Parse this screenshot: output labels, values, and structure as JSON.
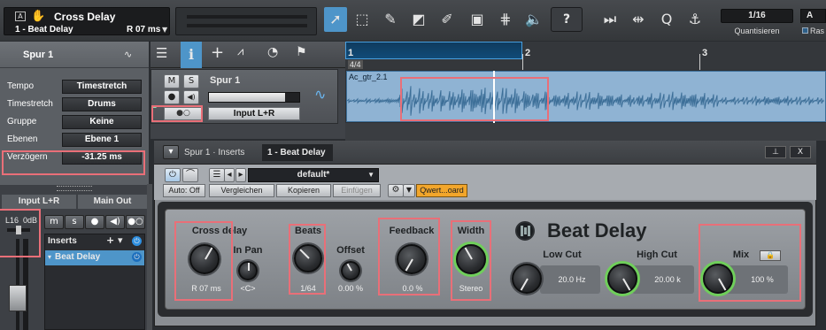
{
  "header": {
    "track_title": "Cross Delay",
    "track_subtitle": "1 - Beat Delay",
    "delay_readout": "R 07 ms",
    "quantize_value": "1/16",
    "quantize_label": "Quantisieren",
    "right_value": "A",
    "right_label": "Ras"
  },
  "toolbar": {
    "help_label": "?"
  },
  "inspector": {
    "track_name": "Spur 1",
    "rows": [
      {
        "label": "Tempo",
        "value": "Timestretch"
      },
      {
        "label": "Timestretch",
        "value": "Drums"
      },
      {
        "label": "Gruppe",
        "value": "Keine"
      },
      {
        "label": "Ebenen",
        "value": "Ebene 1"
      },
      {
        "label": "Verzögern",
        "value": "-31.25 ms"
      }
    ]
  },
  "channel": {
    "input_label": "Input L+R",
    "output_label": "Main Out",
    "pan_value": "L16",
    "gain_value": "0dB",
    "inserts_label": "Inserts",
    "insert_item": "Beat Delay"
  },
  "track": {
    "name": "Spur 1",
    "input": "Input L+R",
    "mute": "M",
    "solo": "S"
  },
  "ruler": {
    "marks": [
      "1",
      "2",
      "3"
    ],
    "time_sig": "4/4"
  },
  "clip": {
    "name": "Ac_gtr_2.1"
  },
  "plugin": {
    "breadcrumb": "Spur 1 · Inserts",
    "tab": "1 - Beat Delay",
    "preset": "default*",
    "auto": "Auto: Off",
    "compare": "Vergleichen",
    "copy": "Kopieren",
    "paste": "Einfügen",
    "keyboard": "Qwert...oard",
    "logo": "Beat Delay",
    "pin": "⊥",
    "close": "X"
  },
  "params": {
    "cross_delay": {
      "label": "Cross delay",
      "value": "R 07 ms"
    },
    "in_pan": {
      "label": "In Pan",
      "value": "<C>"
    },
    "beats": {
      "label": "Beats",
      "value": "1/64"
    },
    "offset": {
      "label": "Offset",
      "value": "0.00 %"
    },
    "feedback": {
      "label": "Feedback",
      "value": "0.0 %"
    },
    "width": {
      "label": "Width",
      "value": "Stereo"
    },
    "low_cut": {
      "label": "Low Cut",
      "value": "20.0 Hz"
    },
    "high_cut": {
      "label": "High Cut",
      "value": "20.00 k"
    },
    "mix": {
      "label": "Mix",
      "value": "100 %"
    }
  }
}
